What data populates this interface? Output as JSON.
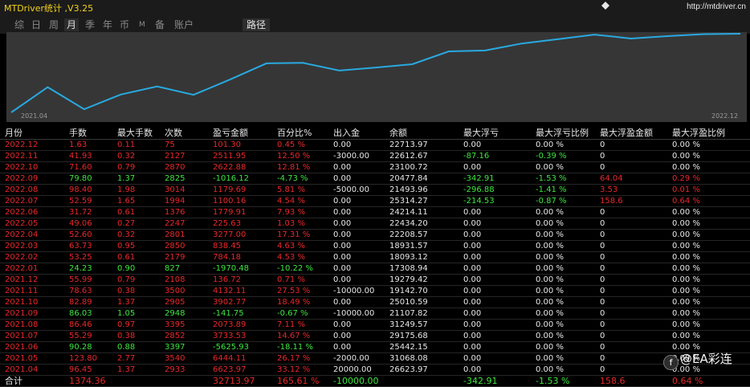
{
  "window": {
    "title": "MTDriver统计 ,V3.25",
    "url": "http://mtdriver.cn"
  },
  "tabs": [
    {
      "label": "综",
      "active": false
    },
    {
      "label": "日",
      "active": false
    },
    {
      "label": "周",
      "active": false
    },
    {
      "label": "月",
      "active": true
    },
    {
      "label": "季",
      "active": false
    },
    {
      "label": "年",
      "active": false
    },
    {
      "label": "币",
      "active": false
    },
    {
      "label": "M",
      "active": false
    },
    {
      "label": "备",
      "active": false
    },
    {
      "label": "账户",
      "active": false
    }
  ],
  "path_button": "路径",
  "colors": {
    "line": "#29a9e0",
    "chart_bg": "#363636",
    "profit": "#e8282a",
    "loss": "#3ee63e"
  },
  "chart_data": {
    "type": "line",
    "x": [
      "2021.04",
      "2021.05",
      "2021.06",
      "2021.07",
      "2021.08",
      "2021.09",
      "2021.10",
      "2021.11",
      "2021.12",
      "2022.01",
      "2022.02",
      "2022.03",
      "2022.04",
      "2022.05",
      "2022.06",
      "2022.07",
      "2022.08",
      "2022.09",
      "2022.10",
      "2022.11",
      "2022.12"
    ],
    "series": [
      {
        "values": [
          6623.97,
          13068.08,
          7442.15,
          11175.68,
          13249.57,
          11107.82,
          15010.59,
          19142.7,
          19279.42,
          17308.94,
          18093.12,
          18931.57,
          22208.57,
          22434.2,
          24214.11,
          25314.27,
          26493.96,
          25477.84,
          26100.72,
          26612.67,
          26713.97
        ]
      }
    ],
    "x_tick_labels": [
      "2021.04",
      "2022.12"
    ],
    "grid": false
  },
  "table": {
    "headers": [
      "月份",
      "手数",
      "最大手数",
      "次数",
      "盈亏金额",
      "百分比%",
      "出入金",
      "余额",
      "最大浮亏",
      "最大浮亏比例",
      "最大浮盈金额",
      "最大浮盈比例"
    ],
    "rows": [
      [
        "2022.12",
        "1.63",
        "0.11",
        "75",
        "101.30",
        "0.45 %",
        "0.00",
        "22713.97",
        "0.00",
        "0.00 %",
        "0",
        "0.00 %"
      ],
      [
        "2022.11",
        "41.93",
        "0.32",
        "2127",
        "2511.95",
        "12.50 %",
        "-3000.00",
        "22612.67",
        "-87.16",
        "-0.39 %",
        "0",
        "0.00 %"
      ],
      [
        "2022.10",
        "71.60",
        "0.79",
        "2870",
        "2622.88",
        "12.81 %",
        "0.00",
        "23100.72",
        "0.00",
        "0.00 %",
        "0",
        "0.00 %"
      ],
      [
        "2022.09",
        "79.80",
        "1.37",
        "2825",
        "-1016.12",
        "-4.73 %",
        "0.00",
        "20477.84",
        "-342.91",
        "-1.53 %",
        "64.04",
        "0.29 %"
      ],
      [
        "2022.08",
        "98.40",
        "1.98",
        "3014",
        "1179.69",
        "5.81 %",
        "-5000.00",
        "21493.96",
        "-296.88",
        "-1.41 %",
        "3.53",
        "0.01 %"
      ],
      [
        "2022.07",
        "52.59",
        "1.65",
        "1994",
        "1100.16",
        "4.54 %",
        "0.00",
        "25314.27",
        "-214.53",
        "-0.87 %",
        "158.6",
        "0.64 %"
      ],
      [
        "2022.06",
        "31.72",
        "0.61",
        "1376",
        "1779.91",
        "7.93 %",
        "0.00",
        "24214.11",
        "0.00",
        "0.00 %",
        "0",
        "0.00 %"
      ],
      [
        "2022.05",
        "49.06",
        "0.27",
        "2247",
        "225.63",
        "1.03 %",
        "0.00",
        "22434.20",
        "0.00",
        "0.00 %",
        "0",
        "0.00 %"
      ],
      [
        "2022.04",
        "52.60",
        "0.32",
        "2801",
        "3277.00",
        "17.31 %",
        "0.00",
        "22208.57",
        "0.00",
        "0.00 %",
        "0",
        "0.00 %"
      ],
      [
        "2022.03",
        "63.73",
        "0.95",
        "2850",
        "838.45",
        "4.63 %",
        "0.00",
        "18931.57",
        "0.00",
        "0.00 %",
        "0",
        "0.00 %"
      ],
      [
        "2022.02",
        "53.25",
        "0.61",
        "2179",
        "784.18",
        "4.53 %",
        "0.00",
        "18093.12",
        "0.00",
        "0.00 %",
        "0",
        "0.00 %"
      ],
      [
        "2022.01",
        "24.23",
        "0.90",
        "827",
        "-1970.48",
        "-10.22 %",
        "0.00",
        "17308.94",
        "0.00",
        "0.00 %",
        "0",
        "0.00 %"
      ],
      [
        "2021.12",
        "55.99",
        "0.79",
        "2108",
        "136.72",
        "0.71 %",
        "0.00",
        "19279.42",
        "0.00",
        "0.00 %",
        "0",
        "0.00 %"
      ],
      [
        "2021.11",
        "78.63",
        "0.38",
        "3500",
        "4132.11",
        "27.53 %",
        "-10000.00",
        "19142.70",
        "0.00",
        "0.00 %",
        "0",
        "0.00 %"
      ],
      [
        "2021.10",
        "82.89",
        "1.37",
        "2905",
        "3902.77",
        "18.49 %",
        "0.00",
        "25010.59",
        "0.00",
        "0.00 %",
        "0",
        "0.00 %"
      ],
      [
        "2021.09",
        "86.03",
        "1.05",
        "2948",
        "-141.75",
        "-0.67 %",
        "-10000.00",
        "21107.82",
        "0.00",
        "0.00 %",
        "0",
        "0.00 %"
      ],
      [
        "2021.08",
        "86.46",
        "0.97",
        "3395",
        "2073.89",
        "7.11 %",
        "0.00",
        "31249.57",
        "0.00",
        "0.00 %",
        "0",
        "0.00 %"
      ],
      [
        "2021.07",
        "55.29",
        "0.38",
        "2852",
        "3733.53",
        "14.67 %",
        "0.00",
        "29175.68",
        "0.00",
        "0.00 %",
        "0",
        "0.00 %"
      ],
      [
        "2021.06",
        "90.28",
        "0.88",
        "3397",
        "-5625.93",
        "-18.11 %",
        "0.00",
        "25442.15",
        "0.00",
        "0.00 %",
        "0",
        "0.00 %"
      ],
      [
        "2021.05",
        "123.80",
        "2.77",
        "3540",
        "6444.11",
        "26.17 %",
        "-2000.00",
        "31068.08",
        "0.00",
        "0.00 %",
        "0",
        "0.00 %"
      ],
      [
        "2021.04",
        "96.45",
        "1.37",
        "2933",
        "6623.97",
        "33.12 %",
        "20000.00",
        "26623.97",
        "0.00",
        "0.00 %",
        "0",
        "0.00 %"
      ]
    ],
    "row_colors": [
      "red",
      "red",
      "red",
      "green",
      "red",
      "red",
      "red",
      "red",
      "red",
      "red",
      "red",
      "green",
      "red",
      "red",
      "red",
      "green",
      "red",
      "red",
      "green",
      "red",
      "red"
    ],
    "total": [
      "合计",
      "1374.36",
      "",
      "",
      "32713.97",
      "165.61 %",
      "-10000.00",
      "",
      "-342.91",
      "-1.53 %",
      "158.6",
      "0.64 %"
    ]
  },
  "watermark": {
    "logo": "f",
    "text": "@EA彩连"
  }
}
